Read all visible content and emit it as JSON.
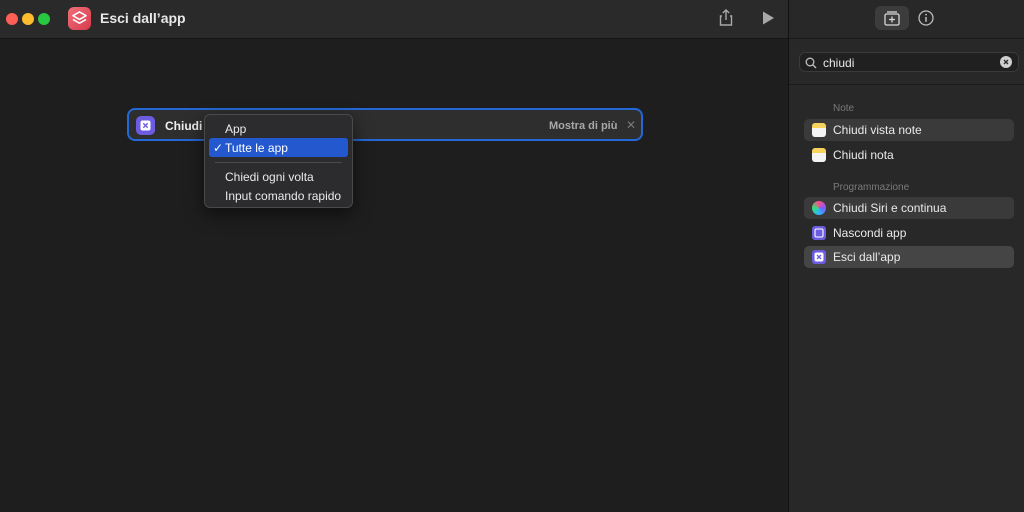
{
  "window": {
    "title": "Esci dall’app"
  },
  "action_card": {
    "label": "Chiudi",
    "hidden_link": "",
    "show_more": "Mostra di più"
  },
  "menu": {
    "items": [
      "App",
      "Tutte le app",
      "Chiedi ogni volta",
      "Input comando rapido"
    ],
    "selected": "Tutte le app"
  },
  "sidebar": {
    "search": {
      "value": "chiudi"
    },
    "sections": [
      {
        "title": "Note",
        "items": [
          "Chiudi vista note",
          "Chiudi nota"
        ]
      },
      {
        "title": "Programmazione",
        "items": [
          "Chiudi Siri e continua",
          "Nascondi app",
          "Esci dall’app"
        ]
      }
    ]
  },
  "colors": {
    "accent": "#2468d8",
    "selection": "#2458cf",
    "action_purple": "#6b5ce0",
    "app_icon": "#e0495a"
  },
  "icons": [
    "shortcuts-icon",
    "share-icon",
    "play-icon",
    "add-action-icon",
    "info-icon",
    "search-icon",
    "clear-icon",
    "close-icon",
    "checkmark-icon",
    "notes-icon",
    "siri-icon",
    "hide-app-icon",
    "quit-app-icon"
  ]
}
